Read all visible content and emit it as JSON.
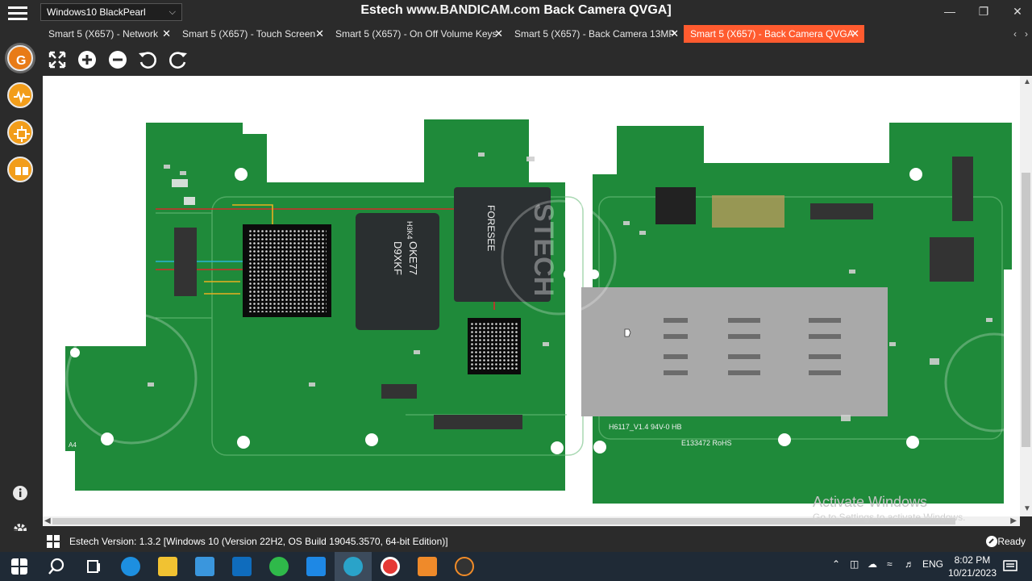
{
  "window": {
    "os_selector": "Windows10 BlackPearl",
    "title": "Estech www.BANDICAM.com Back Camera QVGA]",
    "title_parts": {
      "prefix": "Estech ",
      "watermark": "www.BANDICAM.com",
      "suffix": " Back Camera QVGA]"
    },
    "controls": {
      "minimize": "—",
      "maximize": "❐",
      "close": "✕"
    }
  },
  "tabs": [
    {
      "label": "Smart 5 (X657) - Network",
      "active": false
    },
    {
      "label": "Smart 5 (X657) - Touch Screen",
      "active": false
    },
    {
      "label": "Smart 5 (X657) - On Off Volume Keys",
      "active": false
    },
    {
      "label": "Smart 5 (X657) - Back Camera 13MP",
      "active": false
    },
    {
      "label": "Smart 5 (X657) - Back Camera QVGA",
      "active": true
    }
  ],
  "tab_close": "✕",
  "tab_nav": {
    "prev": "‹",
    "next": "›"
  },
  "sidebar": {
    "items": [
      "logo-icon",
      "signal-icon",
      "circuit-icon",
      "connector-icon"
    ],
    "bottom": [
      "info-icon",
      "settings-icon"
    ]
  },
  "toolbar": [
    "fit-icon",
    "zoom-in-icon",
    "zoom-out-icon",
    "rotate-left-icon",
    "rotate-right-icon"
  ],
  "board": {
    "markings": [
      "H3K4",
      "D9XKF",
      "OKE77",
      "FORESEE",
      "STECH",
      "H6117_V1.4",
      "94V-0 HB",
      "E133472 RoHS",
      "A4"
    ]
  },
  "activation": {
    "title": "Activate Windows",
    "subtitle": "Go to Settings to activate Windows."
  },
  "status": {
    "version": "Estech Version: 1.3.2 [Windows 10 (Version 22H2, OS Build 19045.3570, 64-bit Edition)]",
    "state": "Ready"
  },
  "taskbar": {
    "language": "ENG",
    "time": "8:02 PM",
    "date": "10/21/2023",
    "pinned": [
      "start-icon",
      "search-icon",
      "task-view-icon",
      "edge-icon",
      "file-explorer-icon",
      "store-icon",
      "mail-icon",
      "notepad-plus-icon",
      "app-blue-icon",
      "estech-icon",
      "record-icon",
      "media-icon",
      "player-icon"
    ]
  },
  "colors": {
    "accent_tab": "#ff5b2f",
    "sidebar_orange": "#f29d1a",
    "pcb_green": "#1f8a3a"
  }
}
